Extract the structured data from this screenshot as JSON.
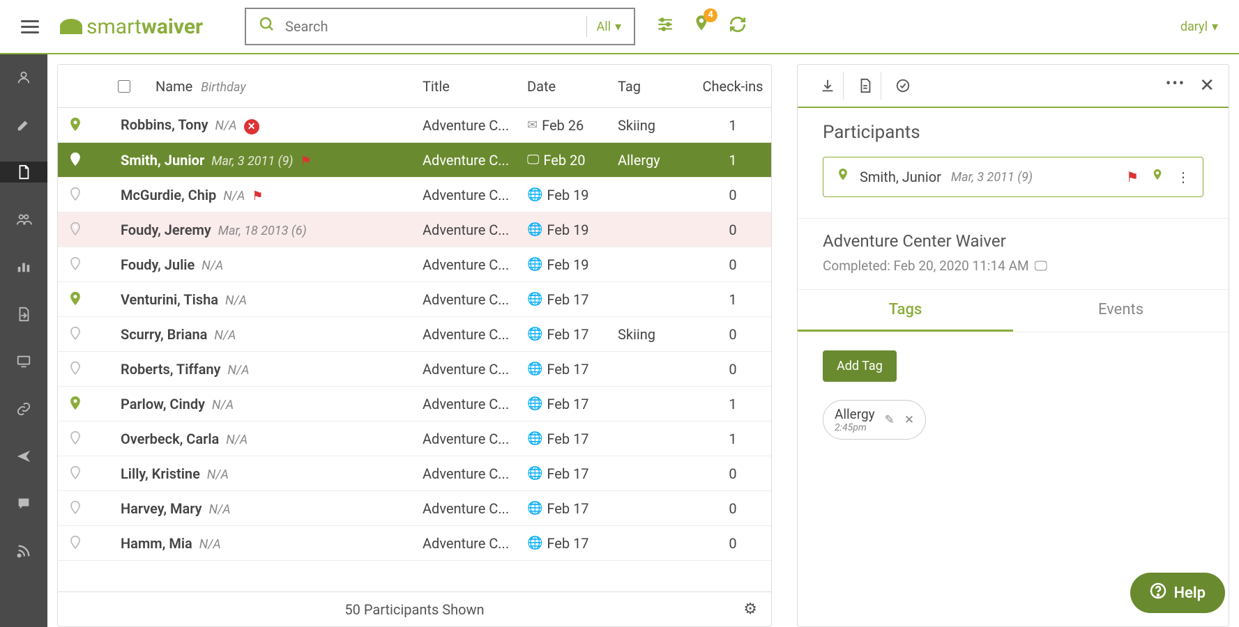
{
  "header": {
    "logo_left": "smart",
    "logo_right": "waiver",
    "search_placeholder": "Search",
    "search_scope": "All",
    "notif_count": "4",
    "user": "daryl"
  },
  "table": {
    "headers": {
      "name": "Name",
      "birthday": "Birthday",
      "title": "Title",
      "date": "Date",
      "tag": "Tag",
      "checkins": "Check-ins"
    },
    "footer": "50 Participants Shown",
    "rows": [
      {
        "name": "Robbins, Tony",
        "birthday": "N/A",
        "title": "Adventure C...",
        "date": "Feb 26",
        "tag": "Skiing",
        "checkins": "1",
        "pin": "strong",
        "extra": "x",
        "dateicon": "mail"
      },
      {
        "name": "Smith, Junior",
        "birthday": "Mar, 3 2011 (9)",
        "title": "Adventure C...",
        "date": "Feb 20",
        "tag": "Allergy",
        "checkins": "1",
        "pin": "strong",
        "extra": "flag",
        "dateicon": "desktop",
        "selected": true
      },
      {
        "name": "McGurdie, Chip",
        "birthday": "N/A",
        "title": "Adventure C...",
        "date": "Feb 19",
        "tag": "",
        "checkins": "0",
        "pin": "weak",
        "extra": "flag",
        "dateicon": "globe"
      },
      {
        "name": "Foudy, Jeremy",
        "birthday": "Mar, 18 2013 (6)",
        "title": "Adventure C...",
        "date": "Feb 19",
        "tag": "",
        "checkins": "0",
        "pin": "weak",
        "dateicon": "globe",
        "pink": true
      },
      {
        "name": "Foudy, Julie",
        "birthday": "N/A",
        "title": "Adventure C...",
        "date": "Feb 19",
        "tag": "",
        "checkins": "0",
        "pin": "weak",
        "dateicon": "globe"
      },
      {
        "name": "Venturini, Tisha",
        "birthday": "N/A",
        "title": "Adventure C...",
        "date": "Feb 17",
        "tag": "",
        "checkins": "1",
        "pin": "strong",
        "dateicon": "globe"
      },
      {
        "name": "Scurry, Briana",
        "birthday": "N/A",
        "title": "Adventure C...",
        "date": "Feb 17",
        "tag": "Skiing",
        "checkins": "0",
        "pin": "weak",
        "dateicon": "globe"
      },
      {
        "name": "Roberts, Tiffany",
        "birthday": "N/A",
        "title": "Adventure C...",
        "date": "Feb 17",
        "tag": "",
        "checkins": "0",
        "pin": "weak",
        "dateicon": "globe"
      },
      {
        "name": "Parlow, Cindy",
        "birthday": "N/A",
        "title": "Adventure C...",
        "date": "Feb 17",
        "tag": "",
        "checkins": "1",
        "pin": "strong",
        "dateicon": "globe"
      },
      {
        "name": "Overbeck, Carla",
        "birthday": "N/A",
        "title": "Adventure C...",
        "date": "Feb 17",
        "tag": "",
        "checkins": "1",
        "pin": "weak",
        "dateicon": "globe"
      },
      {
        "name": "Lilly, Kristine",
        "birthday": "N/A",
        "title": "Adventure C...",
        "date": "Feb 17",
        "tag": "",
        "checkins": "0",
        "pin": "weak",
        "dateicon": "globe"
      },
      {
        "name": "Harvey, Mary",
        "birthday": "N/A",
        "title": "Adventure C...",
        "date": "Feb 17",
        "tag": "",
        "checkins": "0",
        "pin": "weak",
        "dateicon": "globe"
      },
      {
        "name": "Hamm, Mia",
        "birthday": "N/A",
        "title": "Adventure C...",
        "date": "Feb 17",
        "tag": "",
        "checkins": "0",
        "pin": "weak",
        "dateicon": "globe"
      }
    ]
  },
  "detail": {
    "participants_title": "Participants",
    "participant": {
      "name": "Smith, Junior",
      "birthday": "Mar, 3 2011 (9)"
    },
    "waiver_title": "Adventure Center Waiver",
    "completed": "Completed: Feb 20, 2020 11:14 AM",
    "tabs": {
      "tags": "Tags",
      "events": "Events"
    },
    "add_tag": "Add Tag",
    "tag": {
      "name": "Allergy",
      "time": "2:45pm"
    }
  },
  "help": "Help"
}
